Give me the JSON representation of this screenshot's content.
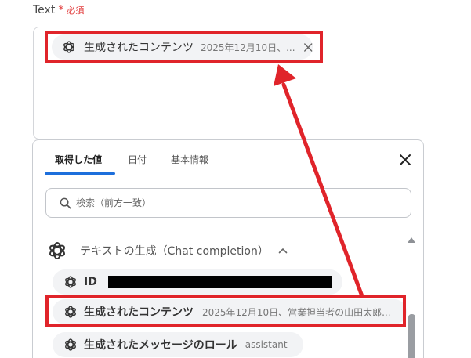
{
  "field": {
    "label": "Text",
    "required_mark": "*",
    "required_text": "必須",
    "chip": {
      "icon": "openai-icon",
      "label": "生成されたコンテンツ",
      "value": "2025年12月10日、...",
      "remove_icon": "close-icon"
    }
  },
  "panel": {
    "tabs": [
      {
        "label": "取得した値",
        "active": true
      },
      {
        "label": "日付",
        "active": false
      },
      {
        "label": "基本情報",
        "active": false
      }
    ],
    "close_icon": "close-icon",
    "search": {
      "placeholder": "検索（前方一致）",
      "value": ""
    },
    "group": {
      "icon": "openai-icon",
      "title": "テキストの生成（Chat completion）",
      "expanded": true
    },
    "items": [
      {
        "label": "ID",
        "value": "",
        "redacted": true
      },
      {
        "label": "生成されたコンテンツ",
        "value": "2025年12月10日、営業担当者の山田太郎..."
      },
      {
        "label": "生成されたメッセージのロール",
        "value": "assistant"
      }
    ]
  },
  "colors": {
    "highlight": "#e0242a",
    "required": "#e23d3d",
    "tab_active_underline": "#1d6fdc",
    "chip_bg": "#f2f3f5"
  }
}
